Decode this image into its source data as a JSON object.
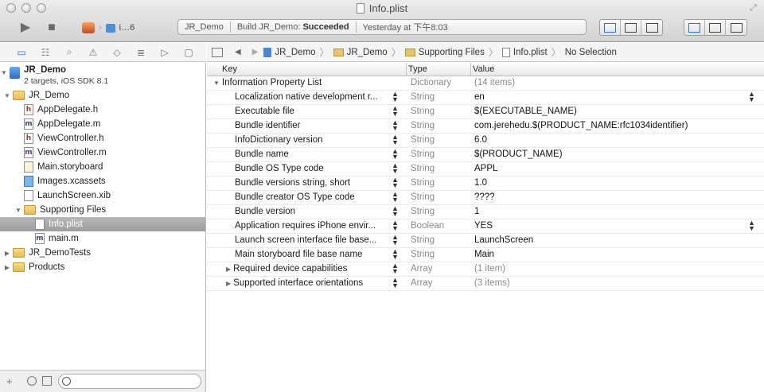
{
  "window": {
    "title": "Info.plist",
    "traffic_lights": [
      "close",
      "minimize",
      "zoom"
    ]
  },
  "toolbar": {
    "scheme_target": "i…6",
    "activity": {
      "project": "JR_Demo",
      "status_prefix": "Build JR_Demo: ",
      "status_result": "Succeeded",
      "timestamp": "Yesterday at 下午8:03"
    }
  },
  "navigator": {
    "project": {
      "name": "JR_Demo",
      "subtitle": "2 targets, iOS SDK 8.1"
    },
    "items": [
      {
        "label": "JR_Demo",
        "kind": "folder",
        "indent": 1,
        "expanded": true
      },
      {
        "label": "AppDelegate.h",
        "kind": "h",
        "indent": 2
      },
      {
        "label": "AppDelegate.m",
        "kind": "m",
        "indent": 2
      },
      {
        "label": "ViewController.h",
        "kind": "h",
        "indent": 2
      },
      {
        "label": "ViewController.m",
        "kind": "m",
        "indent": 2
      },
      {
        "label": "Main.storyboard",
        "kind": "storyboard",
        "indent": 2
      },
      {
        "label": "Images.xcassets",
        "kind": "xcassets",
        "indent": 2
      },
      {
        "label": "LaunchScreen.xib",
        "kind": "xib",
        "indent": 2
      },
      {
        "label": "Supporting Files",
        "kind": "folder",
        "indent": 2,
        "expanded": true
      },
      {
        "label": "Info.plist",
        "kind": "plist",
        "indent": 3,
        "selected": true
      },
      {
        "label": "main.m",
        "kind": "m",
        "indent": 3
      },
      {
        "label": "JR_DemoTests",
        "kind": "folder",
        "indent": 1,
        "expanded": false
      },
      {
        "label": "Products",
        "kind": "folder",
        "indent": 1,
        "expanded": false
      }
    ]
  },
  "jumpbar": {
    "crumbs": [
      "JR_Demo",
      "JR_Demo",
      "Supporting Files",
      "Info.plist",
      "No Selection"
    ]
  },
  "plist": {
    "headers": {
      "key": "Key",
      "type": "Type",
      "value": "Value"
    },
    "root": {
      "key": "Information Property List",
      "type": "Dictionary",
      "value": "(14 items)"
    },
    "rows": [
      {
        "key": "Localization native development r...",
        "type": "String",
        "value": "en",
        "popup": true
      },
      {
        "key": "Executable file",
        "type": "String",
        "value": "$(EXECUTABLE_NAME)"
      },
      {
        "key": "Bundle identifier",
        "type": "String",
        "value": "com.jerehedu.$(PRODUCT_NAME:rfc1034identifier)"
      },
      {
        "key": "InfoDictionary version",
        "type": "String",
        "value": "6.0"
      },
      {
        "key": "Bundle name",
        "type": "String",
        "value": "$(PRODUCT_NAME)"
      },
      {
        "key": "Bundle OS Type code",
        "type": "String",
        "value": "APPL"
      },
      {
        "key": "Bundle versions string, short",
        "type": "String",
        "value": "1.0"
      },
      {
        "key": "Bundle creator OS Type code",
        "type": "String",
        "value": "????"
      },
      {
        "key": "Bundle version",
        "type": "String",
        "value": "1"
      },
      {
        "key": "Application requires iPhone envir...",
        "type": "Boolean",
        "value": "YES",
        "popup": true
      },
      {
        "key": "Launch screen interface file base...",
        "type": "String",
        "value": "LaunchScreen"
      },
      {
        "key": "Main storyboard file base name",
        "type": "String",
        "value": "Main"
      },
      {
        "key": "Required device capabilities",
        "type": "Array",
        "value": "(1 item)",
        "collapsible": true
      },
      {
        "key": "Supported interface orientations",
        "type": "Array",
        "value": "(3 items)",
        "collapsible": true
      }
    ]
  }
}
